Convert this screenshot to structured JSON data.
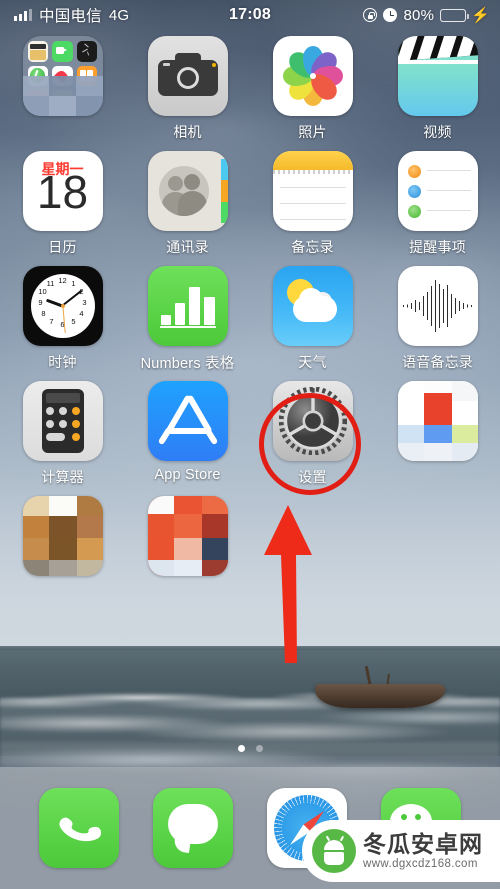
{
  "status_bar": {
    "signal_icon": "signal-bars-icon",
    "carrier": "中国电信",
    "network": "4G",
    "time": "17:08",
    "lock_icon": "rotation-lock-icon",
    "alarm_icon": "alarm-clock-icon",
    "battery_percent": "80%",
    "battery_color": "#4cd964",
    "charging_icon": "lightning-bolt-icon"
  },
  "home_screen": {
    "rows": [
      [
        {
          "name": "folder",
          "label": "",
          "icon": "folder-icon",
          "censored": true
        },
        {
          "name": "camera",
          "label": "相机",
          "icon": "camera-icon"
        },
        {
          "name": "photos",
          "label": "照片",
          "icon": "photos-pinwheel-icon"
        },
        {
          "name": "videos",
          "label": "视频",
          "icon": "clapperboard-icon"
        }
      ],
      [
        {
          "name": "calendar",
          "label": "日历",
          "icon": "calendar-icon",
          "weekday": "星期一",
          "day": "18"
        },
        {
          "name": "contacts",
          "label": "通讯录",
          "icon": "contacts-icon"
        },
        {
          "name": "notes",
          "label": "备忘录",
          "icon": "notes-icon"
        },
        {
          "name": "reminders",
          "label": "提醒事项",
          "icon": "reminders-icon"
        }
      ],
      [
        {
          "name": "clock",
          "label": "时钟",
          "icon": "analog-clock-icon"
        },
        {
          "name": "numbers",
          "label": "Numbers 表格",
          "icon": "bar-chart-icon"
        },
        {
          "name": "weather",
          "label": "天气",
          "icon": "sun-cloud-icon"
        },
        {
          "name": "voice-memos",
          "label": "语音备忘录",
          "icon": "waveform-icon"
        }
      ],
      [
        {
          "name": "calculator",
          "label": "计算器",
          "icon": "calculator-icon"
        },
        {
          "name": "app-store",
          "label": "App Store",
          "icon": "app-store-icon"
        },
        {
          "name": "settings",
          "label": "设置",
          "icon": "gear-icon",
          "highlighted": true
        },
        {
          "name": "censored-app-1",
          "label": "",
          "icon": "pixelated-icon",
          "censored": true
        }
      ],
      [
        {
          "name": "censored-app-2",
          "label": "",
          "icon": "pixelated-icon",
          "censored": true
        },
        {
          "name": "censored-app-3",
          "label": "",
          "icon": "pixelated-icon",
          "censored": true
        }
      ]
    ]
  },
  "annotation": {
    "highlight_target": "设置",
    "ring_color": "#e21e14",
    "arrow_color": "#ee2b18",
    "arrow_direction": "up"
  },
  "page_dots": {
    "count": 2,
    "active_index": 0
  },
  "dock": {
    "items": [
      {
        "name": "phone",
        "icon": "phone-handset-icon",
        "color": "#4cc93a"
      },
      {
        "name": "messages",
        "icon": "speech-bubble-icon",
        "color": "#4cc93a"
      },
      {
        "name": "safari",
        "icon": "compass-icon",
        "color": "#2f9ce8"
      },
      {
        "name": "wechat",
        "icon": "wechat-bubbles-icon",
        "color": "#4cc93a"
      }
    ]
  },
  "watermark": {
    "site_name": "冬瓜安卓网",
    "url": "www.dgxcdz168.com",
    "logo_icon": "android-mascot-icon",
    "logo_color": "#57b846"
  }
}
